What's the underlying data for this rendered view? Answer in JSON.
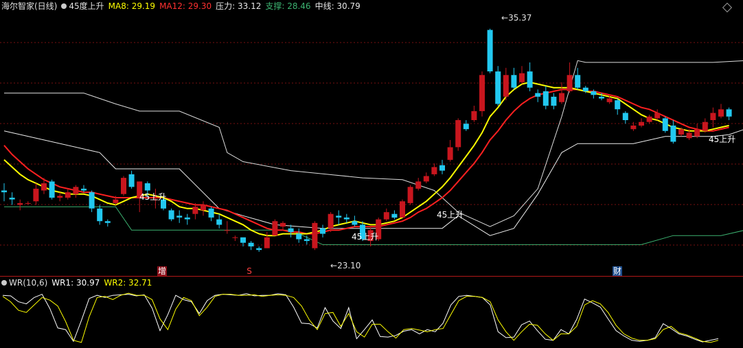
{
  "header": {
    "title": "海尔智家(日线)",
    "indicator_name": "45度上升",
    "ma8_label": "MA8: 29.19",
    "ma12_label": "MA12: 29.30",
    "pressure_label": "压力: 33.12",
    "support_label": "支撑: 28.46",
    "midline_label": "中线: 30.79"
  },
  "annotations": {
    "high_price": "35.37",
    "low_price": "23.10",
    "signal_text": "45上升",
    "marker_zeng": "增",
    "marker_s": "S",
    "marker_cai": "财"
  },
  "wr_header": {
    "name": "WR(10,6)",
    "wr1_label": "WR1: 30.97",
    "wr2_label": "WR2: 32.71"
  },
  "colors": {
    "background": "#000000",
    "up_candle": "#c8161e",
    "down_candle": "#22c8f0",
    "ma8": "#ffff00",
    "ma12": "#ff2020",
    "pressure": "#dddddd",
    "midline": "#eeeeee",
    "support": "#3cb371",
    "grid": "#7a1010",
    "wr1": "#ffffff",
    "wr2": "#ffff00"
  },
  "chart_data": [
    {
      "type": "candlestick",
      "title": "海尔智家(日线)",
      "y_range": [
        22.5,
        36.2
      ],
      "candles": [
        [
          26.4,
          26.3,
          26.8,
          25.8
        ],
        [
          26.0,
          25.9,
          26.3,
          25.6
        ],
        [
          25.6,
          25.7,
          25.9,
          25.3
        ],
        [
          25.7,
          25.7,
          25.8,
          25.6
        ],
        [
          25.8,
          26.5,
          26.8,
          25.6
        ],
        [
          26.4,
          26.8,
          27.1,
          26.2
        ],
        [
          26.9,
          26.0,
          27.0,
          25.9
        ],
        [
          26.0,
          26.1,
          26.3,
          25.8
        ],
        [
          26.0,
          26.3,
          26.5,
          25.9
        ],
        [
          26.2,
          26.6,
          26.7,
          26.0
        ],
        [
          26.5,
          26.4,
          26.7,
          26.3
        ],
        [
          26.3,
          25.4,
          26.4,
          25.2
        ],
        [
          25.4,
          24.7,
          25.6,
          24.5
        ],
        [
          24.7,
          24.6,
          24.8,
          24.4
        ],
        [
          25.7,
          25.9,
          26.1,
          25.6
        ],
        [
          26.2,
          27.1,
          27.2,
          26.1
        ],
        [
          27.3,
          26.6,
          27.5,
          26.5
        ],
        [
          26.0,
          26.9,
          26.9,
          25.2
        ],
        [
          26.8,
          26.4,
          26.9,
          26.0
        ],
        [
          25.9,
          25.9,
          26.5,
          25.4
        ],
        [
          25.9,
          25.4,
          26.0,
          25.3
        ],
        [
          25.3,
          24.8,
          25.4,
          24.7
        ],
        [
          25.0,
          24.9,
          25.3,
          24.6
        ],
        [
          24.9,
          24.8,
          25.1,
          24.5
        ],
        [
          25.1,
          25.5,
          25.7,
          24.8
        ],
        [
          25.3,
          25.6,
          25.8,
          25.0
        ],
        [
          25.4,
          24.9,
          25.5,
          24.7
        ],
        [
          24.8,
          24.5,
          25.1,
          24.3
        ],
        [
          24.2,
          24.2,
          24.7,
          24.0
        ],
        [
          23.8,
          23.8,
          23.9,
          23.6
        ],
        [
          23.8,
          23.5,
          23.8,
          23.3
        ],
        [
          23.5,
          23.3,
          23.6,
          23.1
        ],
        [
          23.2,
          23.1,
          23.3,
          23.0
        ],
        [
          23.2,
          23.8,
          24.1,
          23.2
        ],
        [
          23.9,
          24.7,
          24.8,
          23.9
        ],
        [
          24.4,
          24.6,
          24.7,
          24.2
        ],
        [
          24.3,
          24.1,
          24.5,
          23.8
        ],
        [
          24.0,
          23.7,
          24.3,
          23.5
        ],
        [
          23.7,
          23.6,
          23.9,
          23.4
        ],
        [
          23.2,
          24.6,
          24.7,
          23.1
        ],
        [
          24.3,
          24.0,
          24.5,
          23.8
        ],
        [
          24.3,
          25.1,
          25.2,
          24.1
        ],
        [
          25.0,
          24.9,
          25.3,
          24.5
        ],
        [
          24.9,
          24.8,
          25.1,
          24.6
        ],
        [
          24.7,
          24.5,
          25.0,
          24.4
        ],
        [
          24.5,
          23.7,
          24.7,
          23.6
        ],
        [
          23.6,
          24.2,
          24.4,
          23.3
        ],
        [
          23.7,
          24.8,
          24.9,
          23.6
        ],
        [
          24.8,
          25.2,
          25.4,
          24.7
        ],
        [
          25.1,
          24.9,
          25.3,
          24.8
        ],
        [
          24.9,
          25.8,
          25.9,
          24.9
        ],
        [
          25.7,
          26.6,
          26.7,
          25.6
        ],
        [
          26.5,
          26.9,
          27.1,
          26.4
        ],
        [
          26.9,
          27.2,
          27.4,
          26.8
        ],
        [
          27.3,
          27.7,
          27.9,
          27.2
        ],
        [
          27.8,
          27.5,
          28.1,
          27.3
        ],
        [
          28.1,
          28.8,
          29.2,
          28.0
        ],
        [
          28.8,
          30.3,
          30.4,
          28.6
        ],
        [
          30.1,
          29.8,
          30.3,
          29.7
        ],
        [
          30.3,
          30.8,
          31.1,
          30.2
        ],
        [
          30.8,
          32.8,
          33.0,
          30.5
        ],
        [
          35.3,
          33.0,
          35.37,
          32.9
        ],
        [
          33.0,
          31.2,
          33.3,
          31.1
        ],
        [
          31.6,
          32.8,
          33.2,
          31.4
        ],
        [
          32.8,
          32.1,
          33.2,
          32.0
        ],
        [
          32.4,
          32.9,
          33.3,
          32.3
        ],
        [
          33.0,
          32.1,
          33.5,
          31.9
        ],
        [
          31.8,
          31.6,
          32.0,
          31.3
        ],
        [
          31.9,
          31.1,
          32.2,
          30.9
        ],
        [
          31.6,
          31.1,
          31.8,
          30.9
        ],
        [
          31.3,
          31.8,
          32.4,
          31.2
        ],
        [
          31.9,
          32.8,
          33.5,
          31.8
        ],
        [
          32.8,
          32.1,
          33.2,
          32.0
        ],
        [
          32.1,
          31.9,
          32.2,
          31.8
        ],
        [
          31.9,
          31.7,
          32.0,
          31.5
        ],
        [
          31.6,
          31.5,
          31.8,
          31.4
        ],
        [
          31.3,
          31.5,
          31.7,
          31.2
        ],
        [
          31.4,
          30.9,
          31.5,
          30.6
        ],
        [
          30.7,
          30.3,
          30.8,
          30.1
        ],
        [
          29.8,
          30.0,
          30.2,
          29.7
        ],
        [
          30.0,
          30.2,
          30.4,
          29.9
        ],
        [
          30.2,
          30.5,
          30.6,
          30.1
        ],
        [
          30.4,
          30.7,
          30.9,
          30.3
        ],
        [
          30.4,
          29.7,
          30.5,
          29.6
        ],
        [
          30.0,
          29.1,
          30.3,
          29.0
        ],
        [
          29.5,
          29.8,
          29.9,
          29.4
        ],
        [
          29.3,
          29.6,
          29.8,
          29.2
        ],
        [
          29.4,
          29.8,
          30.1,
          29.3
        ],
        [
          29.7,
          30.2,
          30.4,
          29.6
        ],
        [
          30.3,
          30.7,
          31.0,
          29.9
        ],
        [
          30.5,
          30.9,
          31.2,
          30.4
        ],
        [
          30.9,
          30.5,
          31.0,
          30.3
        ]
      ],
      "ma8": [
        28.1,
        27.7,
        27.3,
        27.0,
        26.8,
        26.6,
        26.4,
        26.3,
        26.2,
        26.2,
        26.2,
        26.1,
        25.9,
        25.7,
        25.6,
        25.8,
        26.0,
        26.1,
        26.2,
        26.1,
        26.0,
        25.8,
        25.5,
        25.4,
        25.4,
        25.3,
        25.2,
        25.1,
        24.9,
        24.7,
        24.5,
        24.2,
        24.0,
        23.9,
        23.9,
        24.0,
        24.0,
        24.0,
        24.0,
        24.1,
        24.2,
        24.4,
        24.5,
        24.6,
        24.7,
        24.6,
        24.5,
        24.5,
        24.6,
        24.7,
        24.9,
        25.2,
        25.5,
        25.8,
        26.2,
        26.6,
        27.1,
        27.7,
        28.3,
        28.9,
        29.6,
        30.5,
        31.0,
        31.6,
        32.0,
        32.3,
        32.4,
        32.3,
        32.2,
        32.1,
        32.1,
        32.1,
        32.0,
        31.9,
        31.8,
        31.7,
        31.6,
        31.5,
        31.2,
        30.9,
        30.6,
        30.4,
        30.3,
        30.1,
        29.9,
        29.8,
        29.7,
        29.7,
        29.7,
        29.8,
        29.9,
        30.0
      ],
      "ma12": [
        28.9,
        28.4,
        28.0,
        27.6,
        27.3,
        27.0,
        26.8,
        26.6,
        26.5,
        26.4,
        26.3,
        26.3,
        26.2,
        26.1,
        26.0,
        26.0,
        26.0,
        26.0,
        26.0,
        26.0,
        26.0,
        25.9,
        25.8,
        25.7,
        25.6,
        25.6,
        25.5,
        25.4,
        25.3,
        25.1,
        24.9,
        24.7,
        24.5,
        24.3,
        24.2,
        24.2,
        24.1,
        24.1,
        24.0,
        24.0,
        24.1,
        24.2,
        24.2,
        24.3,
        24.4,
        24.4,
        24.4,
        24.4,
        24.5,
        24.6,
        24.7,
        24.9,
        25.2,
        25.4,
        25.7,
        26.0,
        26.4,
        26.9,
        27.4,
        27.9,
        28.5,
        29.2,
        29.7,
        30.3,
        30.8,
        31.2,
        31.5,
        31.7,
        31.8,
        31.9,
        32.0,
        32.0,
        32.0,
        31.9,
        31.9,
        31.8,
        31.7,
        31.6,
        31.4,
        31.2,
        31.0,
        30.9,
        30.7,
        30.5,
        30.3,
        30.1,
        29.9,
        29.8,
        29.7,
        29.7,
        29.8,
        29.9
      ],
      "pressure_line": [
        [
          0,
          31.8
        ],
        [
          10,
          31.8
        ],
        [
          14,
          31.2
        ],
        [
          17,
          30.8
        ],
        [
          22,
          30.8
        ],
        [
          27,
          29.9
        ],
        [
          28,
          28.5
        ],
        [
          30,
          28.0
        ],
        [
          36,
          27.5
        ],
        [
          45,
          27.1
        ],
        [
          50,
          27.0
        ],
        [
          54,
          26.4
        ],
        [
          57,
          25.2
        ],
        [
          60,
          24.6
        ],
        [
          61,
          24.4
        ],
        [
          64,
          25.0
        ],
        [
          67,
          26.5
        ],
        [
          70,
          30.5
        ],
        [
          72,
          33.6
        ],
        [
          73,
          33.5
        ],
        [
          79,
          33.5
        ],
        [
          89,
          33.5
        ],
        [
          93,
          33.6
        ],
        [
          99,
          33.6
        ]
      ],
      "midline": [
        [
          0,
          29.7
        ],
        [
          12,
          28.5
        ],
        [
          14,
          27.6
        ],
        [
          22,
          27.6
        ],
        [
          27,
          25.4
        ],
        [
          30,
          25.0
        ],
        [
          34,
          24.5
        ],
        [
          40,
          24.3
        ],
        [
          55,
          24.3
        ],
        [
          57,
          25.0
        ],
        [
          61,
          23.9
        ],
        [
          64,
          24.3
        ],
        [
          67,
          26.2
        ],
        [
          70,
          28.5
        ],
        [
          72,
          29.0
        ],
        [
          79,
          29.0
        ],
        [
          83,
          29.4
        ],
        [
          89,
          29.4
        ],
        [
          91,
          29.5
        ],
        [
          93,
          29.8
        ],
        [
          96,
          30.8
        ],
        [
          99,
          31.3
        ]
      ],
      "support_line": [
        [
          0,
          25.5
        ],
        [
          14,
          25.5
        ],
        [
          16,
          24.2
        ],
        [
          36,
          24.2
        ],
        [
          40,
          23.4
        ],
        [
          43,
          23.4
        ],
        [
          80,
          23.4
        ],
        [
          84,
          23.9
        ],
        [
          90,
          23.9
        ],
        [
          93,
          24.2
        ],
        [
          96,
          25.0
        ],
        [
          97,
          26.4
        ],
        [
          99,
          27.5
        ],
        [
          101,
          28.3
        ],
        [
          103,
          28.5
        ]
      ],
      "signal_labels": [
        [
          23,
          "45上升"
        ],
        [
          55,
          "45上升"
        ],
        [
          70,
          "45上升"
        ],
        [
          103,
          "45上升"
        ]
      ]
    },
    {
      "type": "line",
      "title": "WR(10,6)",
      "y_range": [
        0,
        100
      ],
      "series": [
        {
          "name": "WR1",
          "values": [
            8,
            9,
            20,
            24,
            12,
            6,
            33,
            69,
            72,
            94,
            55,
            14,
            8,
            12,
            8,
            7,
            6,
            9,
            7,
            32,
            74,
            44,
            8,
            16,
            20,
            42,
            18,
            8,
            6,
            7,
            8,
            5,
            9,
            8,
            8,
            5,
            7,
            30,
            60,
            61,
            69,
            31,
            56,
            70,
            31,
            89,
            72,
            54,
            85,
            86,
            83,
            75,
            72,
            80,
            72,
            76,
            60,
            26,
            10,
            8,
            10,
            12,
            26,
            76,
            87,
            86,
            63,
            56,
            74,
            90,
            92,
            72,
            80,
            53,
            15,
            22,
            30,
            52,
            74,
            84,
            92,
            94,
            92,
            87,
            61,
            70,
            80,
            84,
            90,
            95,
            92,
            89
          ]
        },
        {
          "name": "WR2",
          "values": [
            10,
            20,
            36,
            40,
            26,
            12,
            17,
            28,
            57,
            92,
            96,
            48,
            12,
            10,
            16,
            8,
            4,
            8,
            8,
            16,
            52,
            72,
            34,
            12,
            18,
            46,
            30,
            10,
            6,
            6,
            8,
            8,
            7,
            10,
            8,
            7,
            8,
            12,
            28,
            54,
            72,
            42,
            40,
            66,
            42,
            76,
            86,
            62,
            62,
            76,
            88,
            72,
            70,
            73,
            76,
            72,
            70,
            44,
            18,
            10,
            10,
            12,
            20,
            54,
            76,
            92,
            76,
            62,
            64,
            80,
            92,
            80,
            80,
            66,
            26,
            18,
            24,
            40,
            64,
            80,
            88,
            92,
            92,
            89,
            72,
            66,
            78,
            82,
            88,
            94,
            96,
            92
          ]
        }
      ]
    }
  ]
}
